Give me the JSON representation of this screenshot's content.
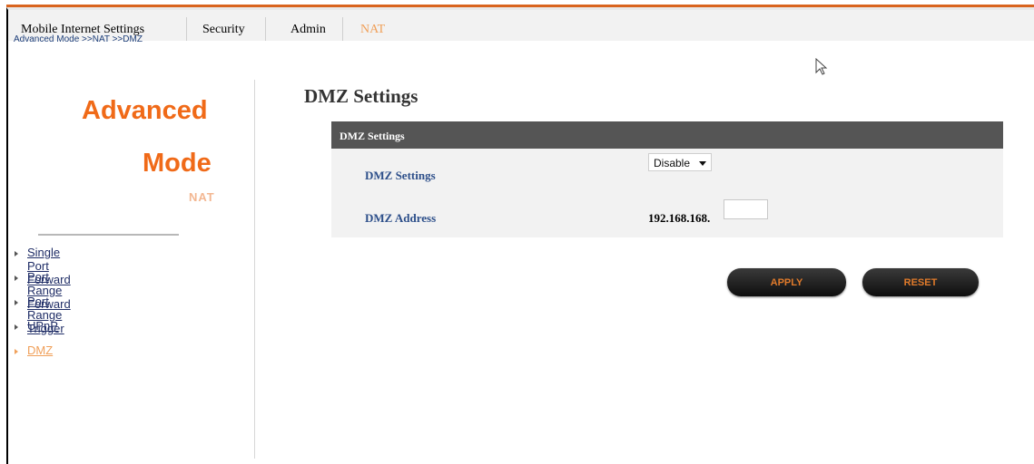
{
  "topnav": {
    "items": [
      {
        "label": "Mobile Internet Settings"
      },
      {
        "label": "Security"
      },
      {
        "label": "Admin"
      },
      {
        "label": "NAT"
      }
    ]
  },
  "breadcrumb": "Advanced Mode >>NAT >>DMZ",
  "left": {
    "title_line1": "Advanced",
    "title_line2": "Mode",
    "section": "NAT",
    "menu": [
      {
        "label": "Single Port Forward"
      },
      {
        "label": "Port Range Forward"
      },
      {
        "label": "Port Range Trigger"
      },
      {
        "label": "UPnP"
      },
      {
        "label": "DMZ"
      }
    ]
  },
  "main": {
    "title": "DMZ Settings",
    "panel_header": "DMZ Settings",
    "rows": {
      "dmz_settings_label": "DMZ Settings",
      "dmz_settings_value": "Disable",
      "dmz_address_label": "DMZ Address",
      "dmz_address_prefix": "192.168.168.",
      "dmz_address_value": ""
    },
    "buttons": {
      "apply": "APPLY",
      "reset": "RESET"
    }
  },
  "colors": {
    "accent_orange": "#f06a18",
    "active_link": "#f0a05a",
    "panel_header": "#555555"
  }
}
